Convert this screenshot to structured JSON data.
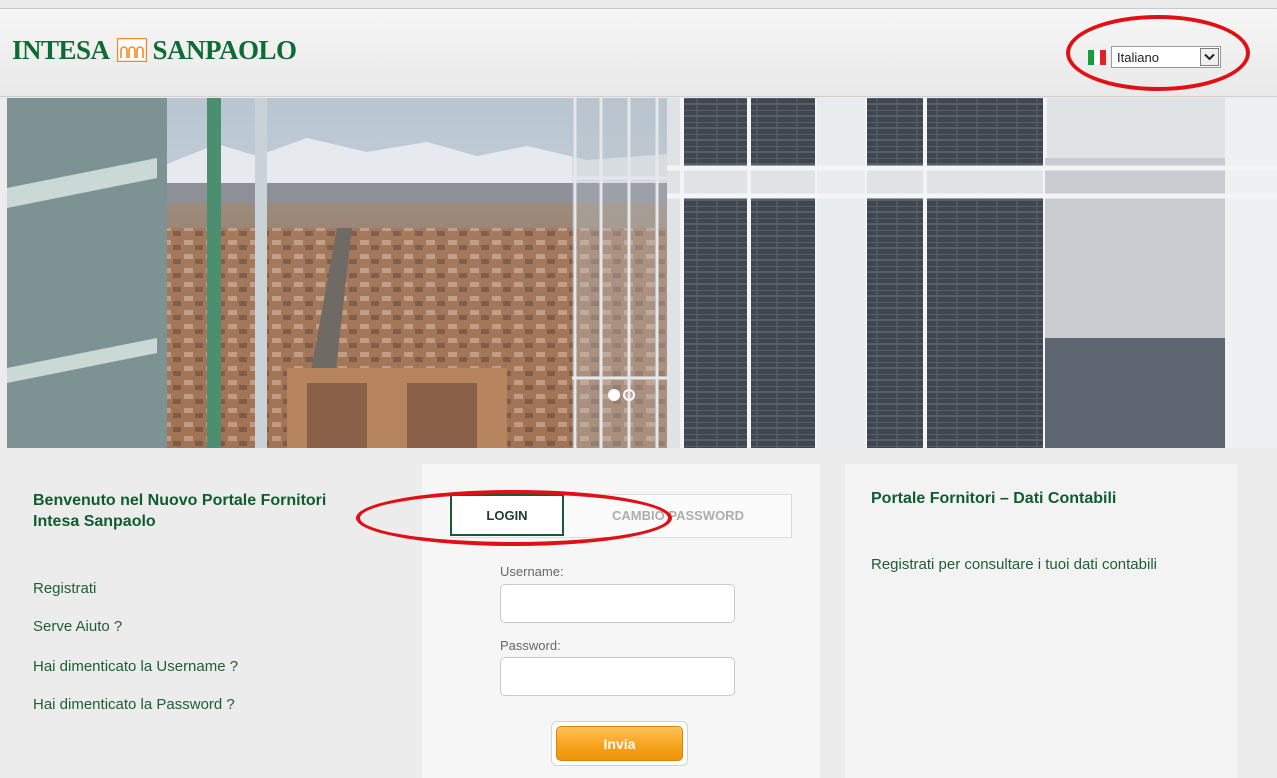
{
  "brand": {
    "part1": "INTESA",
    "part2": "SANPAOLO",
    "color": "#0f6b34"
  },
  "language": {
    "selected": "Italiano",
    "flag_icon": "italy-flag-icon",
    "dropdown_icon": "chevron-down-icon"
  },
  "hero": {
    "slides": 2,
    "active_slide": 1
  },
  "left_panel": {
    "title": "Benvenuto nel Nuovo Portale Fornitori Intesa Sanpaolo",
    "links": [
      "Registrati",
      "Serve Aiuto ?",
      "Hai dimenticato la Username ?",
      "Hai dimenticato la Password ?"
    ]
  },
  "login": {
    "tabs": [
      "LOGIN",
      "CAMBIO PASSWORD"
    ],
    "active_tab": "LOGIN",
    "username_label": "Username:",
    "username_value": "",
    "password_label": "Password:",
    "password_value": "",
    "submit_label": "Invia"
  },
  "right_panel": {
    "title": "Portale Fornitori – Dati Contabili",
    "text": "Registrati per consultare i tuoi dati contabili"
  },
  "colors": {
    "accent": "#0f5d2f",
    "button": "#f7a41e",
    "annotation": "#e20f14"
  }
}
